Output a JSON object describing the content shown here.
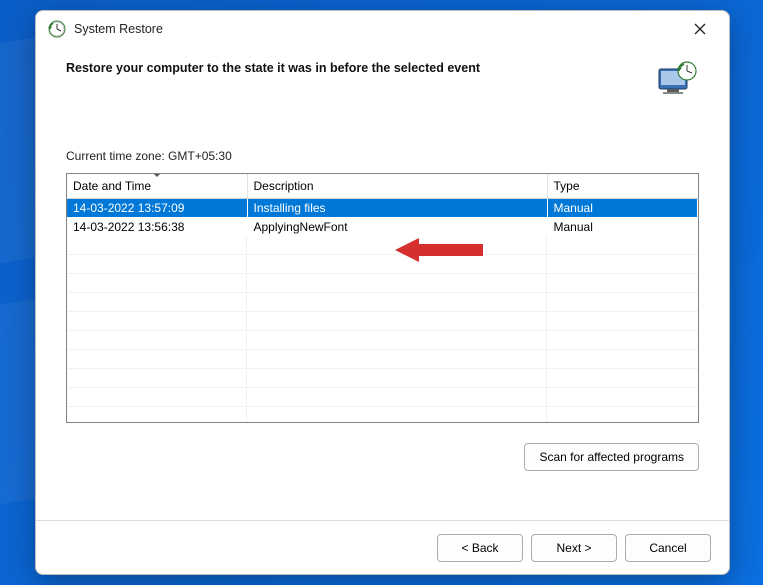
{
  "window": {
    "title": "System Restore"
  },
  "header": {
    "text": "Restore your computer to the state it was in before the selected event"
  },
  "timezone_label": "Current time zone: GMT+05:30",
  "columns": {
    "datetime": "Date and Time",
    "description": "Description",
    "type": "Type"
  },
  "rows": [
    {
      "datetime": "14-03-2022 13:57:09",
      "description": "Installing files",
      "type": "Manual",
      "selected": true
    },
    {
      "datetime": "14-03-2022 13:56:38",
      "description": "ApplyingNewFont",
      "type": "Manual",
      "selected": false
    }
  ],
  "buttons": {
    "scan": "Scan for affected programs",
    "back": "< Back",
    "next": "Next >",
    "cancel": "Cancel"
  }
}
